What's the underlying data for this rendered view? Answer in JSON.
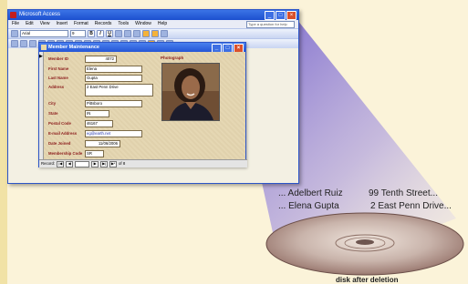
{
  "window": {
    "title": "Microsoft Access",
    "controls": {
      "minimize": "_",
      "maximize": "□",
      "close": "×"
    }
  },
  "menu": {
    "items": [
      "File",
      "Edit",
      "View",
      "Insert",
      "Format",
      "Records",
      "Tools",
      "Window",
      "Help"
    ],
    "help_placeholder": "Type a question for help"
  },
  "toolbar": {
    "font": "Arial",
    "font_size": "9",
    "bold": "B",
    "italic": "I",
    "underline": "U"
  },
  "form": {
    "title": "Member Maintenance",
    "photo_label": "Photograph",
    "fields": [
      {
        "label": "Member ID",
        "value": "4072"
      },
      {
        "label": "First Name",
        "value": "Elena"
      },
      {
        "label": "Last Name",
        "value": "Gupta"
      },
      {
        "label": "Address",
        "value": "2 East Penn Drive"
      },
      {
        "label": "City",
        "value": "Pittsboro"
      },
      {
        "label": "State",
        "value": "IN"
      },
      {
        "label": "Postal Code",
        "value": "46167"
      },
      {
        "label": "E-mail Address",
        "value": "eg@earth.net"
      },
      {
        "label": "Date Joined",
        "value": "11/06/2006"
      },
      {
        "label": "Membership Code",
        "value": "SR"
      }
    ],
    "record_nav": {
      "label": "Record:",
      "of_label": "of 8"
    }
  },
  "disk": {
    "line1_left": "... Adelbert Ruiz",
    "line1_right": "99 Tenth Street...",
    "line2_left": "... Elena Gupta",
    "line2_right": "2 East Penn Drive...",
    "caption": "disk after deletion"
  },
  "colors": {
    "background": "#fbf3d9",
    "beam": "#8a78d8",
    "title_blue": "#2456d6",
    "form_tan": "#e5d7b3",
    "label_red": "#8b1a1a"
  }
}
